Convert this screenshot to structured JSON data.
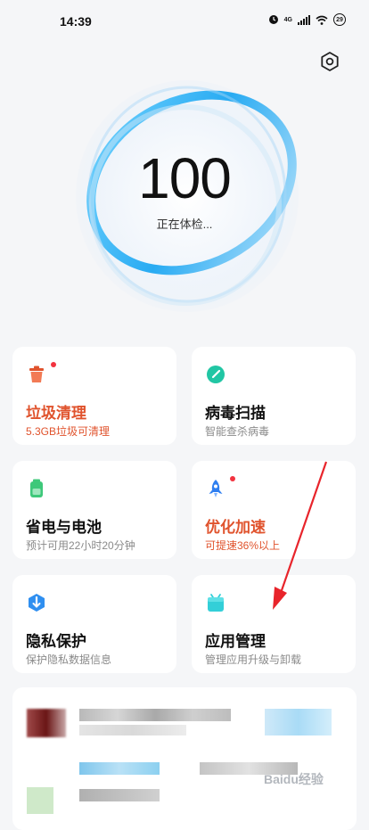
{
  "status_bar": {
    "time": "14:39",
    "network": "4G",
    "battery": "29",
    "icons": [
      "alarm-icon",
      "signal-icon",
      "wifi-icon",
      "battery-icon"
    ]
  },
  "header": {
    "settings_icon": "settings-icon"
  },
  "hero": {
    "score": "100",
    "status": "正在体检..."
  },
  "cards": [
    {
      "title": "垃圾清理",
      "subtitle": "5.3GB垃圾可清理",
      "icon": "trash-icon",
      "has_dot": true,
      "accent": "#e0532d"
    },
    {
      "title": "病毒扫描",
      "subtitle": "智能查杀病毒",
      "icon": "virus-scan-icon",
      "has_dot": false,
      "accent": "#21c6a4"
    },
    {
      "title": "省电与电池",
      "subtitle": "预计可用22小时20分钟",
      "icon": "battery-saver-icon",
      "has_dot": false,
      "accent": "#3ec87a"
    },
    {
      "title": "优化加速",
      "subtitle": "可提速36%以上",
      "icon": "rocket-icon",
      "has_dot": true,
      "accent": "#2f7ff0"
    },
    {
      "title": "隐私保护",
      "subtitle": "保护隐私数据信息",
      "icon": "privacy-shield-icon",
      "has_dot": false,
      "accent": "#2f8ff0"
    },
    {
      "title": "应用管理",
      "subtitle": "管理应用升级与卸载",
      "icon": "android-app-icon",
      "has_dot": false,
      "accent": "#33cfd8"
    }
  ],
  "colors": {
    "background": "#f5f6f8",
    "ring": "#22aaf0",
    "dot": "#f2333f",
    "warning": "#e0532d",
    "arrow": "#e8242b"
  },
  "watermark": "Baidu经验"
}
